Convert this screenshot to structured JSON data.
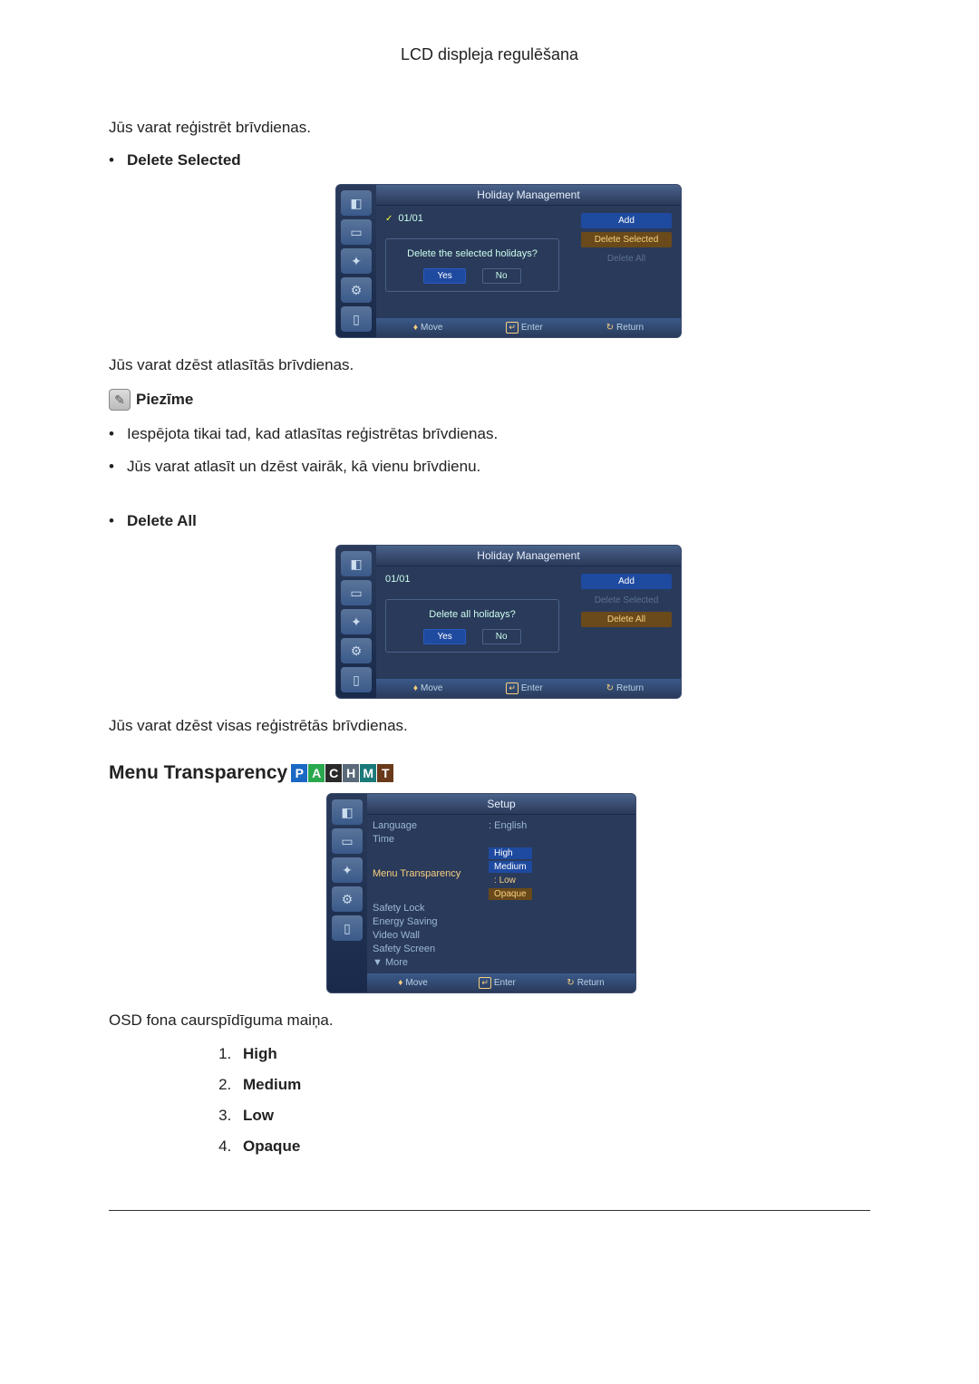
{
  "header": {
    "title": "LCD displeja regulēšana"
  },
  "intro": {
    "register_text": "Jūs varat reģistrēt brīvdienas."
  },
  "delete_selected": {
    "label": "Delete Selected",
    "screenshot": {
      "title": "Holiday Management",
      "date": "01/01",
      "buttons": {
        "add": "Add",
        "delete_selected": "Delete Selected",
        "delete_all": "Delete All"
      },
      "dialog": {
        "question": "Delete the selected holidays?",
        "yes": "Yes",
        "no": "No"
      },
      "footer": {
        "move": "Move",
        "enter": "Enter",
        "return": "Return"
      }
    },
    "after_text": "Jūs varat dzēst atlasītās brīvdienas.",
    "note_label": "Piezīme",
    "note_item1": "Iespējota tikai tad, kad atlasītas reģistrētas brīvdienas.",
    "note_item2": "Jūs varat atlasīt un dzēst vairāk, kā vienu brīvdienu."
  },
  "delete_all": {
    "label": "Delete All",
    "screenshot": {
      "title": "Holiday Management",
      "date": "01/01",
      "buttons": {
        "add": "Add",
        "delete_selected": "Delete Selected",
        "delete_all": "Delete All"
      },
      "dialog": {
        "question": "Delete all holidays?",
        "yes": "Yes",
        "no": "No"
      },
      "footer": {
        "move": "Move",
        "enter": "Enter",
        "return": "Return"
      }
    },
    "after_text": "Jūs varat dzēst visas reģistrētās brīvdienas."
  },
  "menu_transparency": {
    "heading": "Menu Transparency",
    "badges": {
      "P": "P",
      "A": "A",
      "C": "C",
      "H": "H",
      "M": "M",
      "T": "T"
    },
    "screenshot": {
      "title": "Setup",
      "rows": {
        "language": "Language",
        "language_val": "English",
        "time": "Time",
        "menu_transparency": "Menu Transparency",
        "safety_lock": "Safety Lock",
        "energy_saving": "Energy Saving",
        "video_wall": "Video Wall",
        "safety_screen": "Safety Screen",
        "more": "More"
      },
      "options": {
        "high": "High",
        "medium": "Medium",
        "low": "Low",
        "opaque": "Opaque"
      },
      "colon": ":",
      "footer": {
        "move": "Move",
        "enter": "Enter",
        "return": "Return"
      }
    },
    "after_text": "OSD fona caurspīdīguma maiņa.",
    "list": {
      "high": "High",
      "medium": "Medium",
      "low": "Low",
      "opaque": "Opaque"
    }
  }
}
